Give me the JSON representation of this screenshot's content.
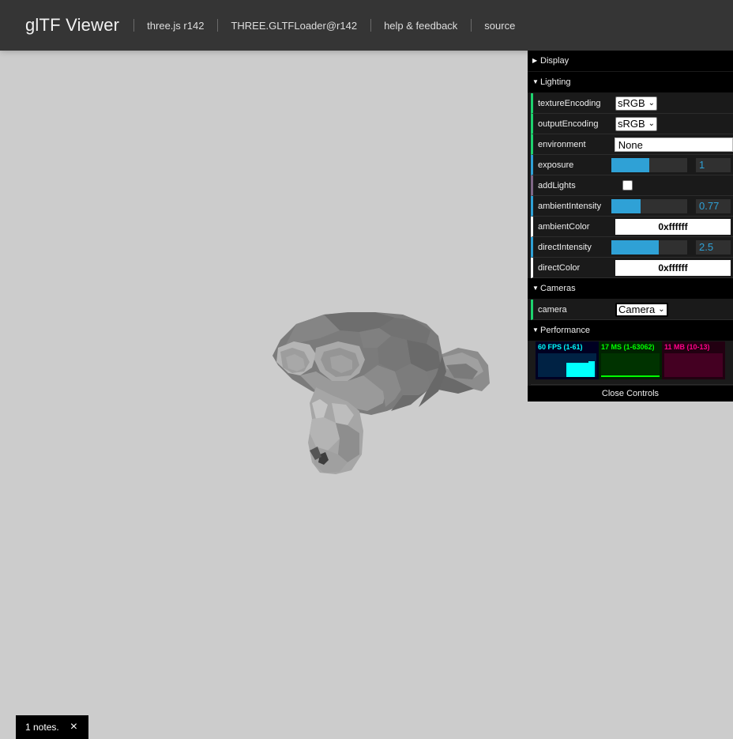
{
  "header": {
    "title": "glTF Viewer",
    "nav": [
      "three.js r142",
      "THREE.GLTFLoader@r142",
      "help & feedback",
      "source"
    ]
  },
  "gui": {
    "display_title": "Display",
    "lighting_title": "Lighting",
    "texture_encoding": {
      "label": "textureEncoding",
      "value": "sRGB"
    },
    "output_encoding": {
      "label": "outputEncoding",
      "value": "sRGB"
    },
    "environment": {
      "label": "environment",
      "value": "None"
    },
    "exposure": {
      "label": "exposure",
      "value": "1",
      "fraction": 0.5
    },
    "add_lights": {
      "label": "addLights",
      "checked": false
    },
    "ambient_intensity": {
      "label": "ambientIntensity",
      "value": "0.77",
      "fraction": 0.385
    },
    "ambient_color": {
      "label": "ambientColor",
      "value": "0xffffff"
    },
    "direct_intensity": {
      "label": "directIntensity",
      "value": "2.5",
      "fraction": 0.625
    },
    "direct_color": {
      "label": "directColor",
      "value": "0xffffff"
    },
    "cameras_title": "Cameras",
    "camera": {
      "label": "camera",
      "value": "Camera"
    },
    "performance_title": "Performance",
    "stats": {
      "fps": "60 FPS (1-61)",
      "ms": "17 MS (1-63062)",
      "mb": "11 MB (10-13)"
    },
    "close_label": "Close Controls"
  },
  "notes": {
    "text": "1 notes.",
    "close": "×"
  },
  "colors": {
    "header_bg": "#353535",
    "viewport_bg": "#cccccc",
    "accent_blue": "#2fa1d6",
    "accent_green": "#1ed36f",
    "fps_color": "#00ffff",
    "ms_color": "#00ff00",
    "mb_color": "#ff0088"
  }
}
